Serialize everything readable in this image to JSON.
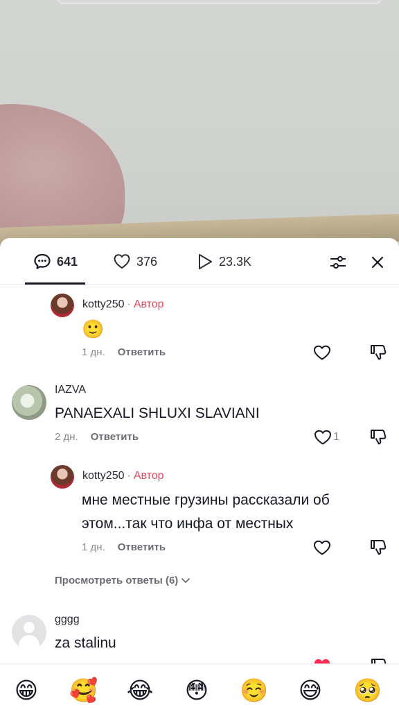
{
  "stats": {
    "comments": "641",
    "likes": "376",
    "plays": "23.3K"
  },
  "comments": [
    {
      "username": "kotty250",
      "author_label": "Автор",
      "text": "🙂",
      "age": "1 дн.",
      "reply_label": "Ответить"
    },
    {
      "username": "IAZVA",
      "text": "PANAEXALI SHLUXI SLAVIANI",
      "age": "2 дн.",
      "reply_label": "Ответить",
      "likes": "1"
    },
    {
      "username": "kotty250",
      "author_label": "Автор",
      "text_line1": "мне местные грузины рассказали об",
      "text_line2": "этом...так что инфа от местных",
      "age": "1 дн.",
      "reply_label": "Ответить"
    },
    {
      "username": "gggg",
      "text": "za stalinu"
    }
  ],
  "view_replies": "Просмотреть ответы (6)",
  "emojis": [
    "😁",
    "🥰",
    "😂",
    "😳",
    "☺️",
    "😅",
    "🥺"
  ],
  "colors": {
    "author_accent": "#e8475d",
    "like_red": "#fe2c55",
    "text_primary": "#161823",
    "text_secondary": "#8a8b91"
  }
}
